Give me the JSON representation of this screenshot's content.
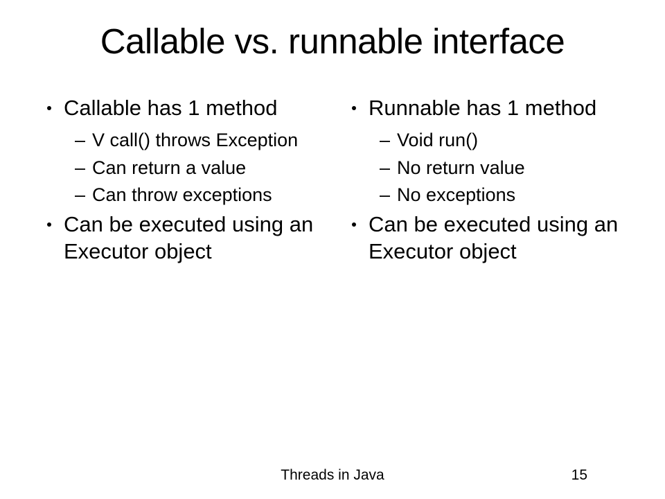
{
  "title": "Callable vs. runnable interface",
  "left": {
    "b1": "Callable has 1 method",
    "s1": "V call() throws Exception",
    "s2": "Can return a value",
    "s3": "Can throw exceptions",
    "b2": "Can be executed using an Executor object"
  },
  "right": {
    "b1": "Runnable has 1 method",
    "s1": "Void run()",
    "s2": "No return value",
    "s3": "No exceptions",
    "b2": "Can be executed using an Executor object"
  },
  "footer": "Threads in Java",
  "page": "15",
  "dash": "–"
}
